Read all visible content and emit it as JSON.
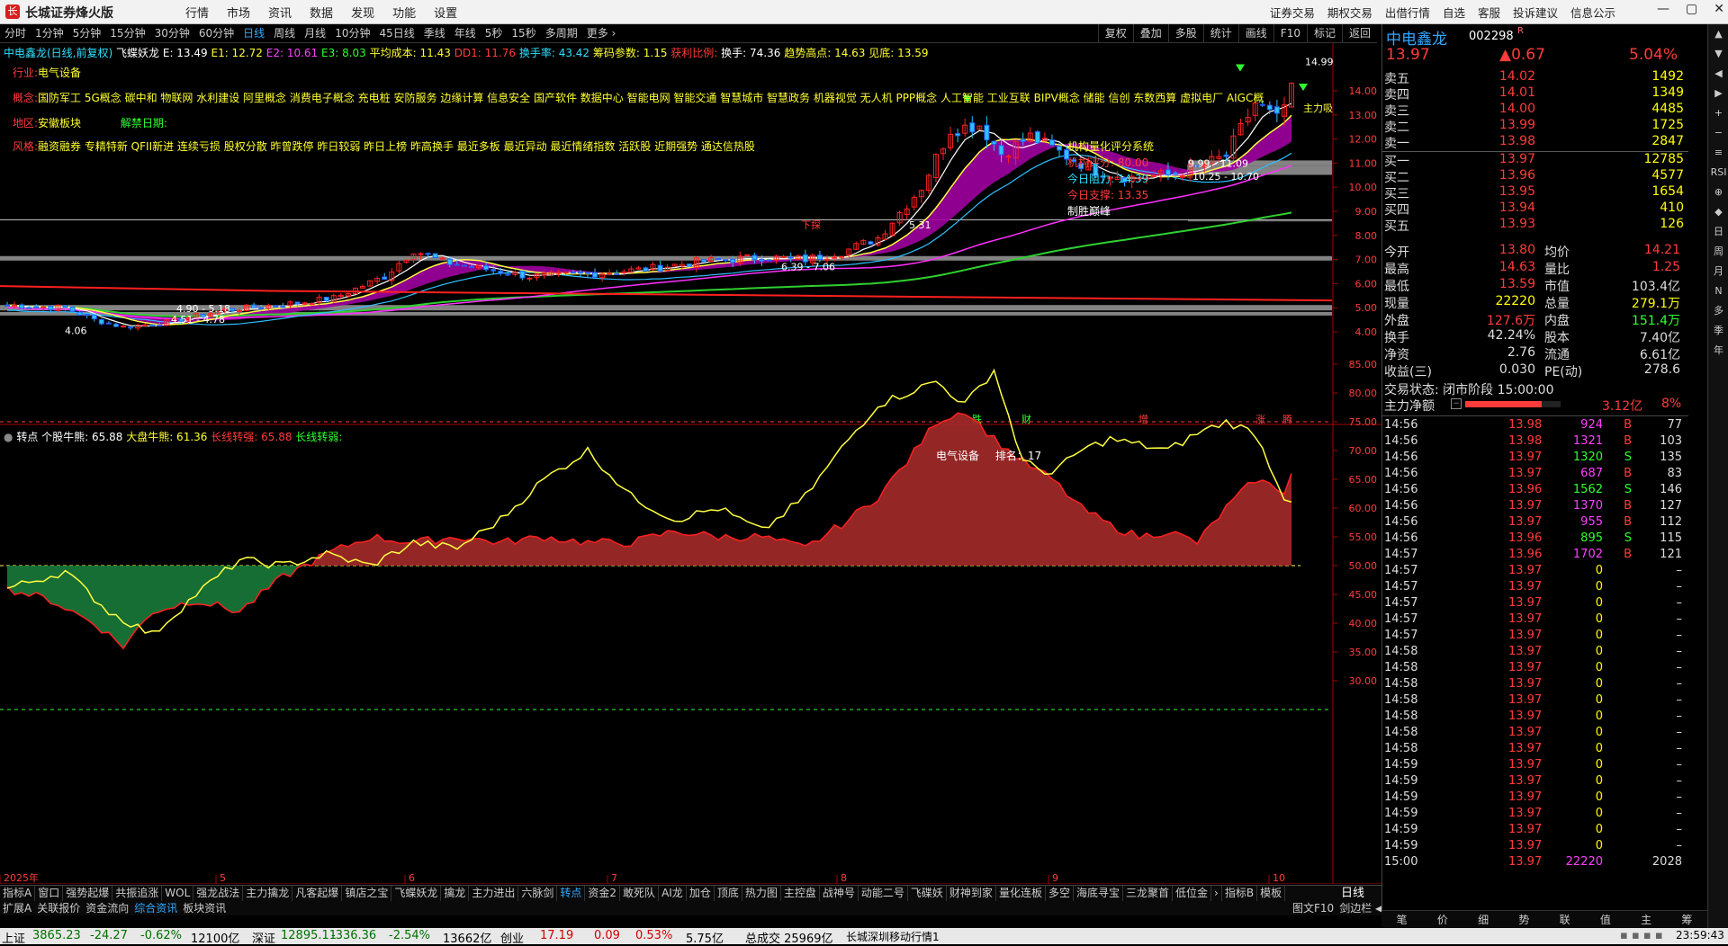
{
  "app": {
    "title": "长城证券烽火版"
  },
  "menu": [
    "行情",
    "市场",
    "资讯",
    "数据",
    "发现",
    "功能",
    "设置"
  ],
  "right_menu": [
    "证券交易",
    "期权交易",
    "出借行情",
    "自选",
    "客服",
    "投诉建议",
    "信息公示"
  ],
  "periods": [
    "分时",
    "1分钟",
    "5分钟",
    "15分钟",
    "30分钟",
    "60分钟",
    "日线",
    "周线",
    "月线",
    "10分钟",
    "45日线",
    "季线",
    "年线",
    "5秒",
    "15秒",
    "多周期",
    "更多 ›"
  ],
  "active_period": "日线",
  "chart_tools": [
    "复权",
    "叠加",
    "多股",
    "统计",
    "画线",
    "F10",
    "标记",
    "返回"
  ],
  "info": {
    "stock": "中电鑫龙(日线,前复权)",
    "indicator": "飞蝶妖龙",
    "e": "E: 13.49",
    "e1": "E1: 12.72",
    "e2": "E2: 10.61",
    "e3": "E3: 8.03",
    "avg_cost": "平均成本: 11.43",
    "dd1": "DD1: 11.76",
    "turnover": "换手率: 43.42",
    "chip": "筹码参数: 1.15",
    "profit": "获利比例:",
    "hand": "换手: 74.36",
    "trend": "趋势高点: 14.63",
    "top": "见底: 13.59"
  },
  "overlay": {
    "industry_label": "行业:",
    "industry": "电气设备",
    "concept_label": "概念:",
    "concepts": "国防军工 5G概念 碳中和 物联网 水利建设 阿里概念 消费电子概念 充电桩 安防服务 边缘计算 信息安全 国产软件 数据中心 智能电网 智能交通 智慧城市 智慧政务 机器视觉 无人机 PPP概念 人工智能 工业互联 BIPV概念 储能 信创 东数西算 虚拟电厂 AIGC概",
    "region_label": "地区:",
    "region": "安徽板块",
    "unlock_label": "解禁日期:",
    "style_label": "风格:",
    "styles": "融资融券 专精特新 QFII新进 连续亏损 股权分散 昨曾跌停 昨日较弱 昨日上榜 昨高换手 最近多板 最近异动 最近情绪指数 活跃股 近期强势 通达信热股"
  },
  "score_box": {
    "title": "机构量化评分系统",
    "score": "机构评分: 80.00",
    "resistance": "今日阻力: 14.39",
    "support": "今日支撑: 13.35",
    "verdict": "制胜巅峰"
  },
  "price_labels": {
    "high": "14.99",
    "low": "4.06",
    "r1": "4.90 - 5.18",
    "r2": "4.51 - 4.78",
    "r3": "6.39 - 7.06",
    "r4": "9.99 - 11.09",
    "r5": "10.25 - 10.70",
    "zhuli": "主力吸",
    "zhangtu": "下探",
    "pt": "5.31"
  },
  "price_axis": [
    "14.00",
    "13.00",
    "12.00",
    "11.00",
    "10.00",
    "9.00",
    "8.00",
    "7.00",
    "6.00",
    "5.00",
    "4.00"
  ],
  "events": [
    "跌",
    "财",
    "增",
    "涨",
    "腾"
  ],
  "sub_info": {
    "name": "转点",
    "v1": "个股牛熊: 65.88",
    "v2": "大盘牛熊: 61.36",
    "v3": "长线转强: 65.88",
    "v4": "长线转弱:"
  },
  "sub_note": {
    "sector": "电气设备",
    "rank": "排名：17"
  },
  "sub_axis": [
    "85.00",
    "80.00",
    "75.00",
    "70.00",
    "65.00",
    "60.00",
    "55.00",
    "50.00",
    "45.00",
    "40.00",
    "35.00",
    "30.00"
  ],
  "date_axis": [
    "2025年",
    "5",
    "6",
    "7",
    "8",
    "9",
    "10"
  ],
  "tabs_row1": [
    "指标A",
    "窗口",
    "强势起爆",
    "共振追涨",
    "WOL",
    "强龙战法",
    "主力擒龙",
    "凡客起爆",
    "镇店之宝",
    "飞蝶妖龙",
    "擒龙",
    "主力进出",
    "六脉剑",
    "转点",
    "资金2",
    "敢死队",
    "AI龙",
    "加仓",
    "顶底",
    "热力图",
    "主控盘",
    "战神号",
    "动能二号",
    "飞碟妖",
    "财神到家",
    "量化连板",
    "多空",
    "海底寻宝",
    "三龙聚首",
    "低位金",
    "›",
    "指标B",
    "模板"
  ],
  "tabs_row2": [
    "扩展A",
    "关联报价",
    "资金流向",
    "综合资讯",
    "板块资讯"
  ],
  "tabs_row2_right": [
    "图文F10",
    "剑边栏 ◀"
  ],
  "daily_label": "日线",
  "quote": {
    "name": "中电鑫龙",
    "code": "002298",
    "tag": "R",
    "price": "13.97",
    "change": "▲0.67",
    "pct": "5.04%",
    "asks": [
      {
        "label": "卖五",
        "price": "14.02",
        "vol": "1492"
      },
      {
        "label": "卖四",
        "price": "14.01",
        "vol": "1349"
      },
      {
        "label": "卖三",
        "price": "14.00",
        "vol": "4485"
      },
      {
        "label": "卖二",
        "price": "13.99",
        "vol": "1725"
      },
      {
        "label": "卖一",
        "price": "13.98",
        "vol": "2847"
      }
    ],
    "bids": [
      {
        "label": "买一",
        "price": "13.97",
        "vol": "12785"
      },
      {
        "label": "买二",
        "price": "13.96",
        "vol": "4577"
      },
      {
        "label": "买三",
        "price": "13.95",
        "vol": "1654"
      },
      {
        "label": "买四",
        "price": "13.94",
        "vol": "410"
      },
      {
        "label": "买五",
        "price": "13.93",
        "vol": "126"
      }
    ],
    "stats": [
      {
        "l1": "今开",
        "v1": "13.80",
        "c1": "#ff3b3b",
        "l2": "均价",
        "v2": "14.21",
        "c2": "#ff3b3b"
      },
      {
        "l1": "最高",
        "v1": "14.63",
        "c1": "#ff3b3b",
        "l2": "量比",
        "v2": "1.25",
        "c2": "#ff3b3b"
      },
      {
        "l1": "最低",
        "v1": "13.59",
        "c1": "#ff3b3b",
        "l2": "市值",
        "v2": "103.4亿",
        "c2": "#ddd"
      },
      {
        "l1": "现量",
        "v1": "22220",
        "c1": "#ff0",
        "l2": "总量",
        "v2": "279.1万",
        "c2": "#ff0"
      },
      {
        "l1": "外盘",
        "v1": "127.6万",
        "c1": "#ff3b3b",
        "l2": "内盘",
        "v2": "151.4万",
        "c2": "#30ff30"
      },
      {
        "l1": "换手",
        "v1": "42.24%",
        "c1": "#ddd",
        "l2": "股本",
        "v2": "7.40亿",
        "c2": "#ddd"
      },
      {
        "l1": "净资",
        "v1": "2.76",
        "c1": "#ddd",
        "l2": "流通",
        "v2": "6.61亿",
        "c2": "#ddd"
      },
      {
        "l1": "收益(三)",
        "v1": "0.030",
        "c1": "#ddd",
        "l2": "PE(动)",
        "v2": "278.6",
        "c2": "#ddd"
      }
    ],
    "trade_state": "交易状态: 闭市阶段 15:00:00",
    "net_label": "主力净额",
    "net_value": "3.12亿",
    "net_pct": "8%",
    "net_bar_fill": 0.8
  },
  "ticks": [
    {
      "t": "14:56",
      "p": "13.98",
      "v": "924",
      "d": "B",
      "n": "77"
    },
    {
      "t": "14:56",
      "p": "13.98",
      "v": "1321",
      "d": "B",
      "n": "103"
    },
    {
      "t": "14:56",
      "p": "13.97",
      "v": "1320",
      "d": "S",
      "n": "135"
    },
    {
      "t": "14:56",
      "p": "13.97",
      "v": "687",
      "d": "B",
      "n": "83"
    },
    {
      "t": "14:56",
      "p": "13.96",
      "v": "1562",
      "d": "S",
      "n": "146"
    },
    {
      "t": "14:56",
      "p": "13.97",
      "v": "1370",
      "d": "B",
      "n": "127"
    },
    {
      "t": "14:56",
      "p": "13.97",
      "v": "955",
      "d": "B",
      "n": "112"
    },
    {
      "t": "14:56",
      "p": "13.96",
      "v": "895",
      "d": "S",
      "n": "115"
    },
    {
      "t": "14:57",
      "p": "13.96",
      "v": "1702",
      "d": "B",
      "n": "121"
    },
    {
      "t": "14:57",
      "p": "13.97",
      "v": "0",
      "d": "",
      "n": "–"
    },
    {
      "t": "14:57",
      "p": "13.97",
      "v": "0",
      "d": "",
      "n": "–"
    },
    {
      "t": "14:57",
      "p": "13.97",
      "v": "0",
      "d": "",
      "n": "–"
    },
    {
      "t": "14:57",
      "p": "13.97",
      "v": "0",
      "d": "",
      "n": "–"
    },
    {
      "t": "14:57",
      "p": "13.97",
      "v": "0",
      "d": "",
      "n": "–"
    },
    {
      "t": "14:58",
      "p": "13.97",
      "v": "0",
      "d": "",
      "n": "–"
    },
    {
      "t": "14:58",
      "p": "13.97",
      "v": "0",
      "d": "",
      "n": "–"
    },
    {
      "t": "14:58",
      "p": "13.97",
      "v": "0",
      "d": "",
      "n": "–"
    },
    {
      "t": "14:58",
      "p": "13.97",
      "v": "0",
      "d": "",
      "n": "–"
    },
    {
      "t": "14:58",
      "p": "13.97",
      "v": "0",
      "d": "",
      "n": "–"
    },
    {
      "t": "14:58",
      "p": "13.97",
      "v": "0",
      "d": "",
      "n": "–"
    },
    {
      "t": "14:58",
      "p": "13.97",
      "v": "0",
      "d": "",
      "n": "–"
    },
    {
      "t": "14:59",
      "p": "13.97",
      "v": "0",
      "d": "",
      "n": "–"
    },
    {
      "t": "14:59",
      "p": "13.97",
      "v": "0",
      "d": "",
      "n": "–"
    },
    {
      "t": "14:59",
      "p": "13.97",
      "v": "0",
      "d": "",
      "n": "–"
    },
    {
      "t": "14:59",
      "p": "13.97",
      "v": "0",
      "d": "",
      "n": "–"
    },
    {
      "t": "14:59",
      "p": "13.97",
      "v": "0",
      "d": "",
      "n": "–"
    },
    {
      "t": "14:59",
      "p": "13.97",
      "v": "0",
      "d": "",
      "n": "–"
    },
    {
      "t": "15:00",
      "p": "13.97",
      "v": "22220",
      "d": "",
      "n": "2028"
    }
  ],
  "right_tabs": [
    "笔",
    "价",
    "细",
    "势",
    "联",
    "值",
    "主",
    "筹"
  ],
  "side_tools": [
    "▲",
    "▼",
    "◀",
    "▶",
    "+",
    "−",
    "≡",
    "RSI",
    "⊕",
    "◆",
    "日",
    "周",
    "月",
    "N",
    "多",
    "季",
    "年"
  ],
  "status": {
    "sh_label": "上证",
    "sh_val": "3865.23",
    "sh_chg": "-24.27",
    "sh_pct": "-0.62%",
    "sh_amt": "12100亿",
    "sz_label": "深证",
    "sz_val": "12895.11",
    "sz_chg": "-336.36",
    "sz_pct": "-2.54%",
    "sz_amt": "13662亿",
    "cy_label": "创业",
    "cy_val": "17.19",
    "cy_chg": "0.09",
    "cy_pct": "0.53%",
    "cy_amt": "5.75亿",
    "total": "总成交 25969亿",
    "feed": "长城深圳移动行情1",
    "time": "23:59:43"
  },
  "colors": {
    "up": "#ff3b3b",
    "down": "#30ff30",
    "accent": "#3aa0ff",
    "fill_red": "#a52a2a",
    "fill_green": "#1a7a3a"
  }
}
